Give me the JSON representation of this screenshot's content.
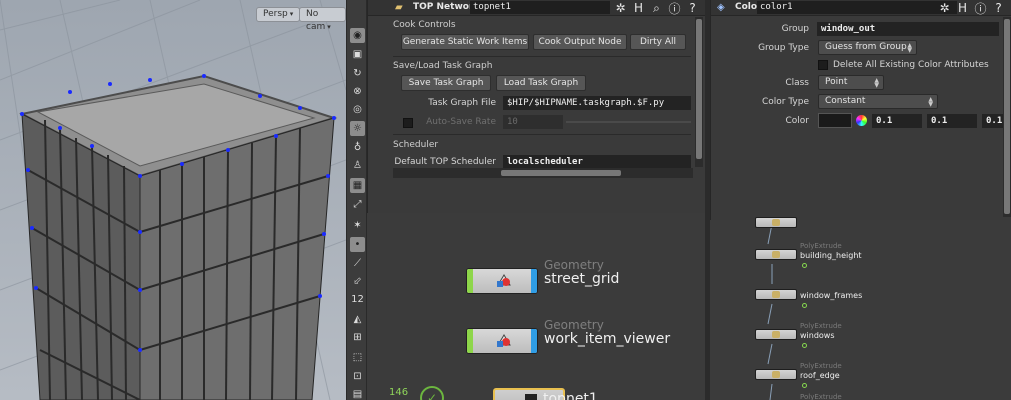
{
  "viewport": {
    "persp_label": "Persp",
    "camera_label": "No cam"
  },
  "shelf": {
    "tools": [
      "eye-icon",
      "lock-icon",
      "rotate-icon",
      "magnet-icon",
      "sphere-icon",
      "bulb-icon",
      "light-icon",
      "person-icon",
      "camera-icon",
      "transform-icon",
      "dot-icon",
      "brush-icon",
      "ruler-icon",
      "sculpt-icon",
      "grid-icon",
      "snap-icon"
    ],
    "ruler_value": "12"
  },
  "top_network": {
    "type_label": "TOP Network",
    "name": "topnet1",
    "cook_controls": {
      "heading": "Cook Controls",
      "generate_label": "Generate Static Work Items",
      "cook_output_label": "Cook Output Node",
      "dirty_all_label": "Dirty All"
    },
    "save_load": {
      "heading": "Save/Load Task Graph",
      "save_label": "Save Task Graph",
      "load_label": "Load Task Graph",
      "file_label": "Task Graph File",
      "file_value": "$HIP/$HIPNAME.taskgraph.$F.py",
      "autosave_label": "Auto-Save Rate",
      "autosave_value": "10"
    },
    "scheduler": {
      "heading": "Scheduler",
      "default_label": "Default TOP Scheduler",
      "default_value": "localscheduler"
    }
  },
  "color_node": {
    "type_label": "Color",
    "name": "color1",
    "group_label": "Group",
    "group_value": "window_out",
    "group_type_label": "Group Type",
    "group_type_value": "Guess from Group",
    "delete_attr_label": "Delete All Existing Color Attributes",
    "class_label": "Class",
    "class_value": "Point",
    "color_type_label": "Color Type",
    "color_type_value": "Constant",
    "color_label": "Color",
    "color_r": "0.1",
    "color_g": "0.1",
    "color_b": "0.1"
  },
  "network": {
    "nodes": [
      {
        "type": "Geometry",
        "name": "street_grid"
      },
      {
        "type": "Geometry",
        "name": "work_item_viewer"
      },
      {
        "type": "",
        "name": "topnet1"
      }
    ],
    "work_item_count": "146"
  },
  "sop_network": {
    "nodes": [
      {
        "type": "PolyExtrude",
        "name": "building_height"
      },
      {
        "type": "",
        "name": "window_frames"
      },
      {
        "type": "PolyExtrude",
        "name": "windows"
      },
      {
        "type": "PolyExtrude",
        "name": "roof_edge"
      },
      {
        "type": "PolyExtrude",
        "name": ""
      }
    ]
  }
}
